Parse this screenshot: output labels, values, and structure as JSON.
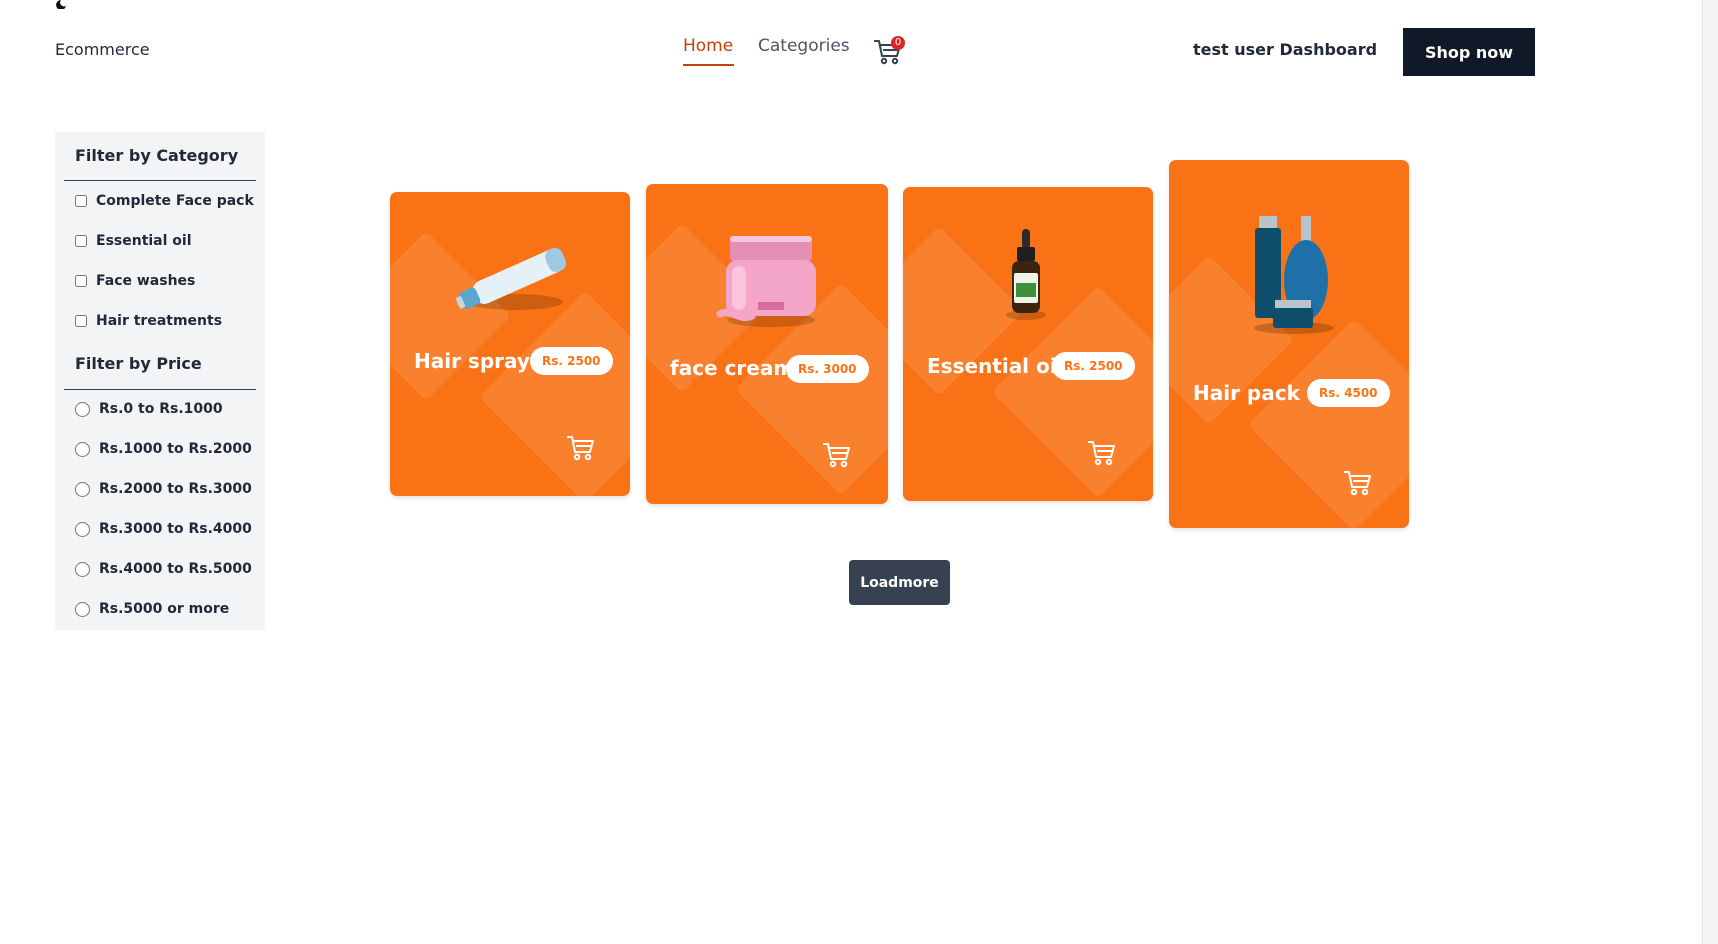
{
  "header": {
    "brand": "Ecommerce",
    "nav": {
      "home": "Home",
      "categories": "Categories"
    },
    "cart_count": "0",
    "dashboard": "test user Dashboard",
    "shop_now": "Shop now"
  },
  "sidebar": {
    "category_heading": "Filter by Category",
    "categories": [
      "Complete Face pack",
      "Essential oil",
      "Face washes",
      "Hair treatments"
    ],
    "price_heading": "Filter by Price",
    "prices": [
      "Rs.0 to Rs.1000",
      "Rs.1000 to Rs.2000",
      "Rs.2000 to Rs.3000",
      "Rs.3000 to Rs.4000",
      "Rs.4000 to Rs.5000",
      "Rs.5000 or more"
    ]
  },
  "products": [
    {
      "name": "Hair spray",
      "price": "Rs. 2500",
      "image": "spray-bottle-icon"
    },
    {
      "name": "face cream",
      "price": "Rs. 3000",
      "image": "cream-jar-icon"
    },
    {
      "name": "Essential oil",
      "price": "Rs. 2500",
      "image": "dropper-bottle-icon"
    },
    {
      "name": "Hair pack",
      "price": "Rs. 4500",
      "image": "bottle-set-icon"
    }
  ],
  "loadmore": "Loadmore",
  "colors": {
    "accent": "#f97316",
    "nav_active": "#c2410c",
    "dark": "#111827",
    "badge": "#dc2626"
  }
}
